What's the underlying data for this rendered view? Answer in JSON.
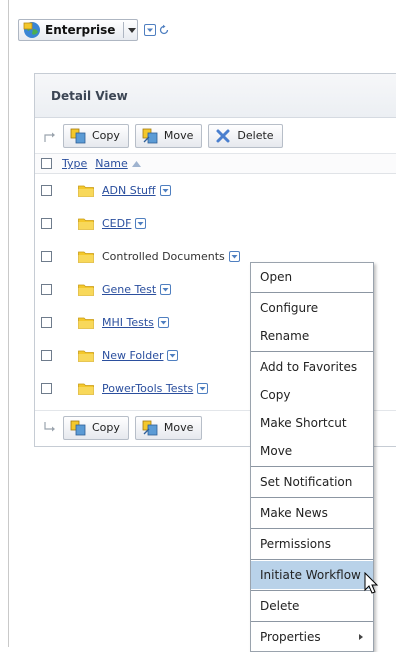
{
  "enterprise": {
    "label": "Enterprise"
  },
  "panel": {
    "title": "Detail View"
  },
  "toolbar": {
    "copy": "Copy",
    "move": "Move",
    "delete": "Delete"
  },
  "table": {
    "headers": {
      "type": "Type",
      "name": "Name"
    },
    "rows": [
      {
        "name": "ADN Stuff"
      },
      {
        "name": "CEDF"
      },
      {
        "name": "Controlled Documents"
      },
      {
        "name": "Gene Test"
      },
      {
        "name": "MHI Tests"
      },
      {
        "name": "New Folder"
      },
      {
        "name": "PowerTools Tests"
      }
    ]
  },
  "context_menu": {
    "items": [
      "Open",
      "Configure",
      "Rename",
      "Add to Favorites",
      "Copy",
      "Make Shortcut",
      "Move",
      "Set Notification",
      "Make News",
      "Permissions",
      "Initiate Workflow",
      "Delete",
      "Properties"
    ],
    "highlighted": "Initiate Workflow"
  },
  "colors": {
    "link": "#2b4f9e",
    "folder": "#f4c82b",
    "highlight": "#b9d2e9"
  }
}
